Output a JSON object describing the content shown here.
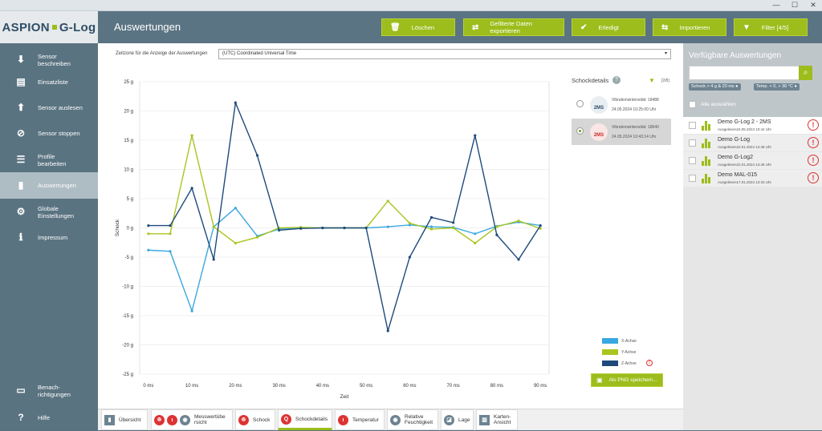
{
  "window": {
    "minimize": "—",
    "maximize": "☐",
    "close": "✕"
  },
  "logo": {
    "part1": "ASPION",
    "part2": "G-Log"
  },
  "page_title": "Auswertungen",
  "toolbar": [
    {
      "label": "Löschen",
      "icon": "trash-icon"
    },
    {
      "label": "Gefilterte Daten exportieren",
      "icon": "export-icon"
    },
    {
      "label": "Erledigt",
      "icon": "check-icon"
    },
    {
      "label": "Importieren",
      "icon": "import-icon"
    },
    {
      "label": "Filter [4/5]",
      "icon": "filter-icon"
    }
  ],
  "sidebar": {
    "items": [
      {
        "label": "Sensor\nbeschreiben",
        "icon": "download-icon"
      },
      {
        "label": "Einsatzliste",
        "icon": "document-icon"
      },
      {
        "label": "Sensor auslesen",
        "icon": "upload-icon"
      },
      {
        "label": "Sensor stoppen",
        "icon": "stop-icon"
      },
      {
        "label": "Profile\nbearbeiten",
        "icon": "profile-icon"
      },
      {
        "label": "Auswertungen",
        "icon": "chart-icon"
      },
      {
        "label": "Globale\nEinstellungen",
        "icon": "gear-icon"
      },
      {
        "label": "Impressum",
        "icon": "info-icon"
      }
    ],
    "bottom": [
      {
        "label": "Benach-\nrichtigungen",
        "icon": "chat-icon"
      },
      {
        "label": "Hilfe",
        "icon": "help-icon"
      }
    ]
  },
  "timezone": {
    "label": "Zeitzone für die Anzeige der Auswertungen",
    "value": "(UTC) Coordinated Universal Time"
  },
  "chart_data": {
    "type": "line",
    "xlabel": "Zeit",
    "ylabel": "Schock",
    "xlim": [
      -2,
      92
    ],
    "ylim": [
      -25,
      25
    ],
    "x_ticks": [
      "0 ms",
      "10 ms",
      "20 ms",
      "30 ms",
      "40 ms",
      "50 ms",
      "60 ms",
      "70 ms",
      "80 ms",
      "90 ms"
    ],
    "y_ticks": [
      "25 g",
      "20 g",
      "15 g",
      "10 g",
      "5 g",
      "0 g",
      "-5 g",
      "-10 g",
      "-15 g",
      "-20 g",
      "-25 g"
    ],
    "x": [
      0,
      5,
      10,
      15,
      20,
      25,
      30,
      35,
      40,
      45,
      50,
      55,
      60,
      65,
      70,
      75,
      80,
      85,
      90
    ],
    "series": [
      {
        "name": "X-Achse",
        "color": "#3aa8e0",
        "values": [
          -3.8,
          -4.0,
          -14.2,
          0.2,
          3.4,
          -1.4,
          -0.2,
          0,
          0,
          0,
          0,
          0.2,
          0.5,
          0.2,
          0.1,
          -1.0,
          0.3,
          1.0,
          0.4
        ]
      },
      {
        "name": "Y-Achse",
        "color": "#a9c520",
        "values": [
          -1.0,
          -1.0,
          15.8,
          0.2,
          -2.6,
          -1.6,
          0,
          0.1,
          0,
          0,
          0,
          4.6,
          0.8,
          -0.2,
          0,
          -2.6,
          0.2,
          1.2,
          -0.1
        ]
      },
      {
        "name": "Z-Achse",
        "color": "#1e4a7c",
        "values": [
          0.4,
          0.4,
          6.8,
          -5.4,
          21.4,
          12.4,
          -0.4,
          -0.1,
          0,
          0,
          0,
          -17.6,
          -5.0,
          1.8,
          0.9,
          15.8,
          -1.2,
          -5.4,
          0.4
        ]
      }
    ]
  },
  "shock": {
    "title": "Schockdetails",
    "count": "[2/8]",
    "items": [
      {
        "l1": "Vibrationsintensität: 18488",
        "l2": "24.05.2024 10:25:00 Uhr",
        "badge": "2MS",
        "selected": false
      },
      {
        "l1": "Vibrationsintensität: 18640",
        "l2": "24.05.2024 10:43:14 Uhr",
        "badge": "2MS",
        "selected": true
      }
    ],
    "legend": [
      {
        "label": "X-Achse",
        "color": "#3aa8e0"
      },
      {
        "label": "Y-Achse",
        "color": "#a9c520"
      },
      {
        "label": "Z-Achse",
        "color": "#1e4a7c",
        "warn": "!"
      }
    ],
    "png_button": "Als PNG speichern..."
  },
  "tabs": [
    {
      "label": "Übersicht"
    },
    {
      "label": "Messwertübe\nrsicht"
    },
    {
      "label": "Schock"
    },
    {
      "label": "Schockdetails"
    },
    {
      "label": "Temperatur"
    },
    {
      "label": "Relative\nFeuchtigkeit"
    },
    {
      "label": "Lage"
    },
    {
      "label": "Karten-\nAnsicht"
    }
  ],
  "right_panel": {
    "title": "Verfügbare Auswertungen",
    "search_placeholder": "",
    "chips": [
      "Schock > 4 g & 20 ms ●",
      "Temp. < 0, > 30 °C ●"
    ],
    "select_all": "Alle auswählen",
    "devices": [
      {
        "name": "Demo G-Log 2 - 2MS",
        "sub": "Ausgelesen24.05.2024 10:44 Uhr",
        "selected": true
      },
      {
        "name": "Demo G-Log",
        "sub": "Ausgelesen22.01.2024 14:48 Uhr",
        "selected": false
      },
      {
        "name": "Demo G-Log2",
        "sub": "Ausgelesen22.01.2024 14:48 Uhr",
        "selected": false
      },
      {
        "name": "Demo MAL-015",
        "sub": "Ausgelesen17.01.2024 13:33 Uhr",
        "selected": false
      }
    ],
    "alert": "!"
  }
}
